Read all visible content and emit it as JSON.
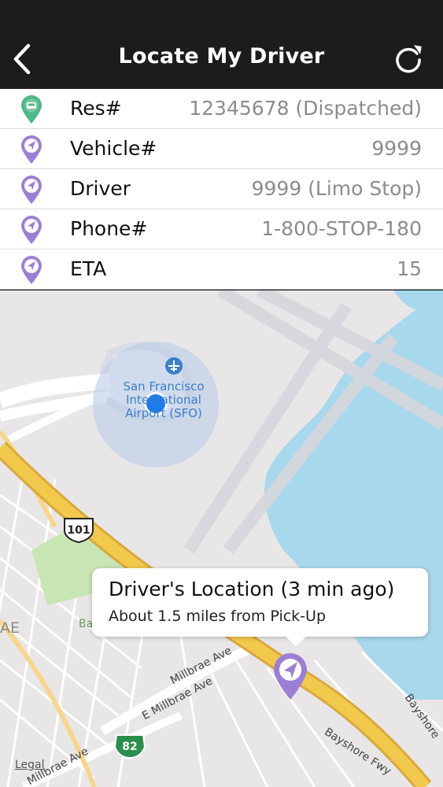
{
  "header": {
    "title": "Locate My Driver"
  },
  "info_rows": [
    {
      "label": "Res#",
      "value": "12345678 (Dispatched)",
      "pin_color": "#4db88a"
    },
    {
      "label": "Vehicle#",
      "value": "9999",
      "pin_color": "#9b7fd6"
    },
    {
      "label": "Driver",
      "value": "9999 (Limo Stop)",
      "pin_color": "#9b7fd6"
    },
    {
      "label": "Phone#",
      "value": "1-800-STOP-180",
      "pin_color": "#9b7fd6"
    },
    {
      "label": "ETA",
      "value": "15",
      "pin_color": "#9b7fd6"
    }
  ],
  "map": {
    "airport_label_line1": "San Francisco",
    "airport_label_line2": "International",
    "airport_label_line3": "Airport (SFO)",
    "highway_101": "101",
    "highway_82": "82",
    "road_millbrae_1": "Millbrae Ave",
    "road_millbrae_2": "E Millbrae Ave",
    "road_millbrae_3": "Millbrae Ave",
    "road_bayshore": "Bayshore Fwy",
    "road_bayshore_2": "Bayshore",
    "partial_label_ae": "AE",
    "partial_label_ba": "Ba",
    "legal": "Legal",
    "water_color": "#a8d8ec",
    "highway_color": "#f2c94c",
    "user_dot_color": "#1a7cf0",
    "driver_pin_color": "#9b7fd6"
  },
  "callout": {
    "title": "Driver's Location (3 min ago)",
    "subtitle": "About 1.5 miles from Pick-Up"
  }
}
